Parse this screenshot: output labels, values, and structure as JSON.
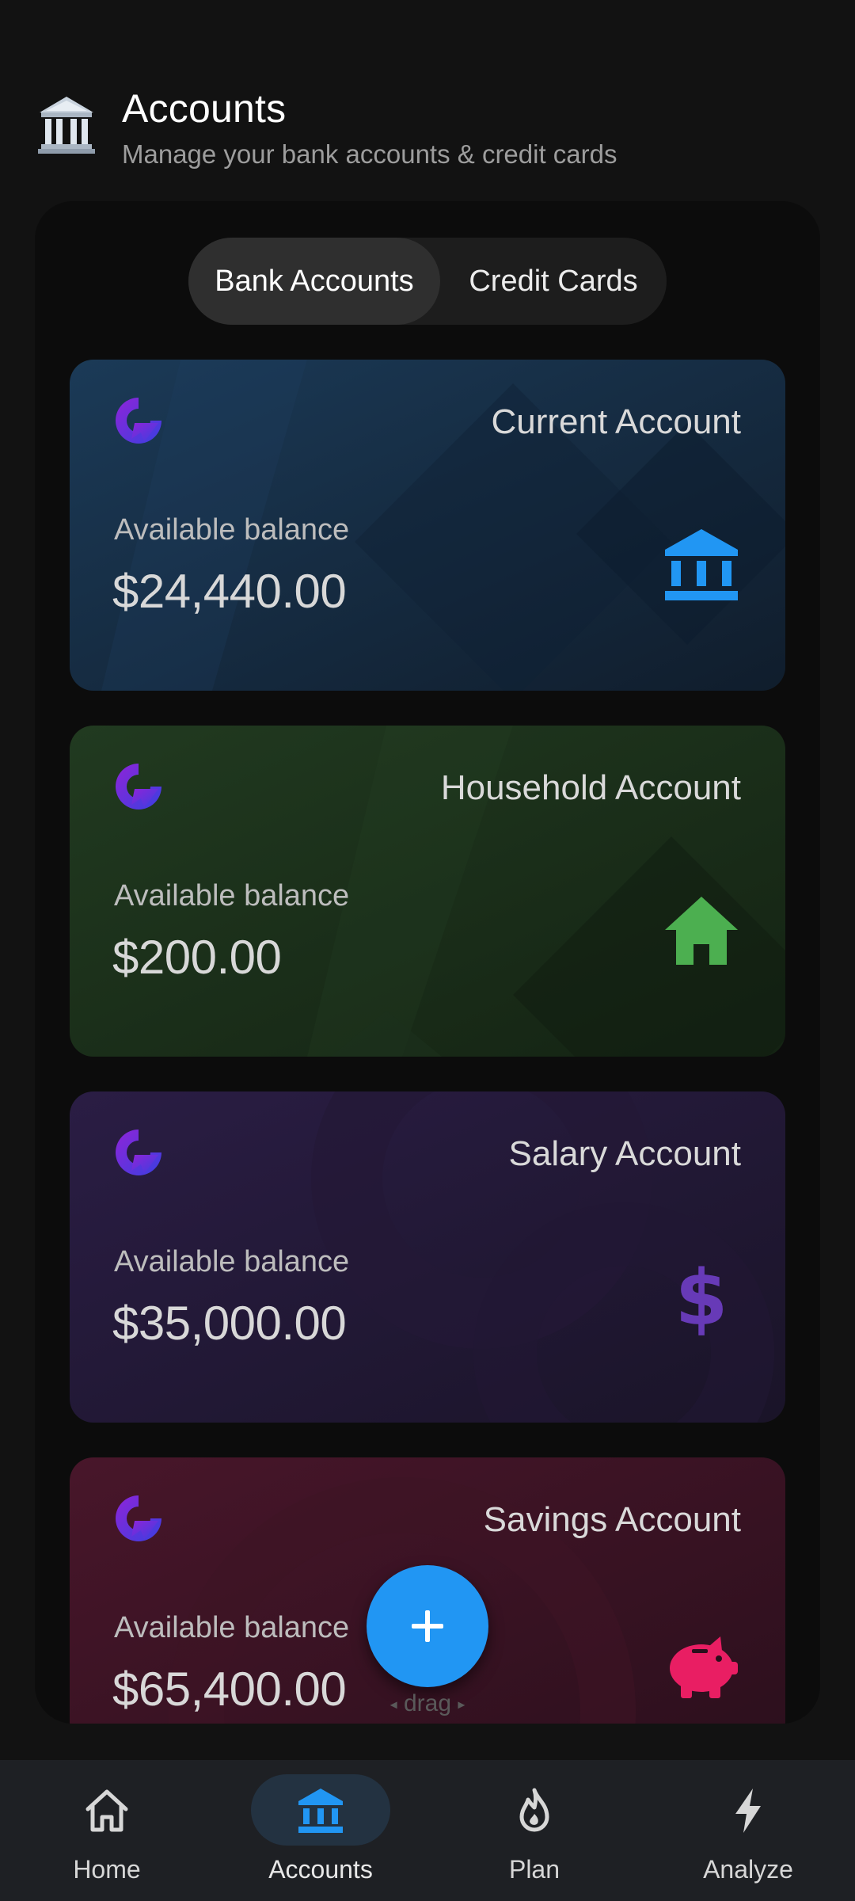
{
  "header": {
    "title": "Accounts",
    "subtitle": "Manage your bank accounts & credit cards",
    "icon": "bank-building-icon"
  },
  "tabs": [
    {
      "label": "Bank Accounts",
      "active": true
    },
    {
      "label": "Credit Cards",
      "active": false
    }
  ],
  "accounts": [
    {
      "name": "Current Account",
      "balance_label": "Available balance",
      "balance": "$24,440.00",
      "icon": "bank-icon",
      "accent": "#2196f3"
    },
    {
      "name": "Household Account",
      "balance_label": "Available balance",
      "balance": "$200.00",
      "icon": "house-icon",
      "accent": "#4caf50"
    },
    {
      "name": "Salary Account",
      "balance_label": "Available balance",
      "balance": "$35,000.00",
      "icon": "dollar-icon",
      "accent": "#673ab7"
    },
    {
      "name": "Savings Account",
      "balance_label": "Available balance",
      "balance": "$65,400.00",
      "icon": "piggy-bank-icon",
      "accent": "#e91e63"
    }
  ],
  "fab": {
    "icon": "plus-icon",
    "hint": "drag"
  },
  "bottom_nav": [
    {
      "label": "Home",
      "icon": "home-icon",
      "active": false
    },
    {
      "label": "Accounts",
      "icon": "bank-icon",
      "active": true
    },
    {
      "label": "Plan",
      "icon": "flame-icon",
      "active": false
    },
    {
      "label": "Analyze",
      "icon": "lightning-icon",
      "active": false
    }
  ]
}
